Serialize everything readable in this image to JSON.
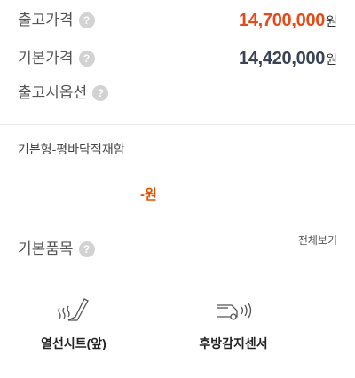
{
  "price_rows": [
    {
      "label": "출고가격",
      "amount": "14,700,000",
      "unit": "원",
      "accent": "#e64a19"
    },
    {
      "label": "기본가격",
      "amount": "14,420,000",
      "unit": "원",
      "accent": "#3a4454"
    },
    {
      "label": "출고시옵션"
    }
  ],
  "help_glyph": "?",
  "trim": {
    "name": "기본형-평바닥적재함",
    "price": "-원"
  },
  "basic_items": {
    "label": "기본품목",
    "view_all": "전체보기",
    "features": [
      {
        "name": "열선시트(앞)",
        "icon": "heated-seat-icon"
      },
      {
        "name": "후방감지센서",
        "icon": "rear-sensor-icon"
      }
    ]
  }
}
